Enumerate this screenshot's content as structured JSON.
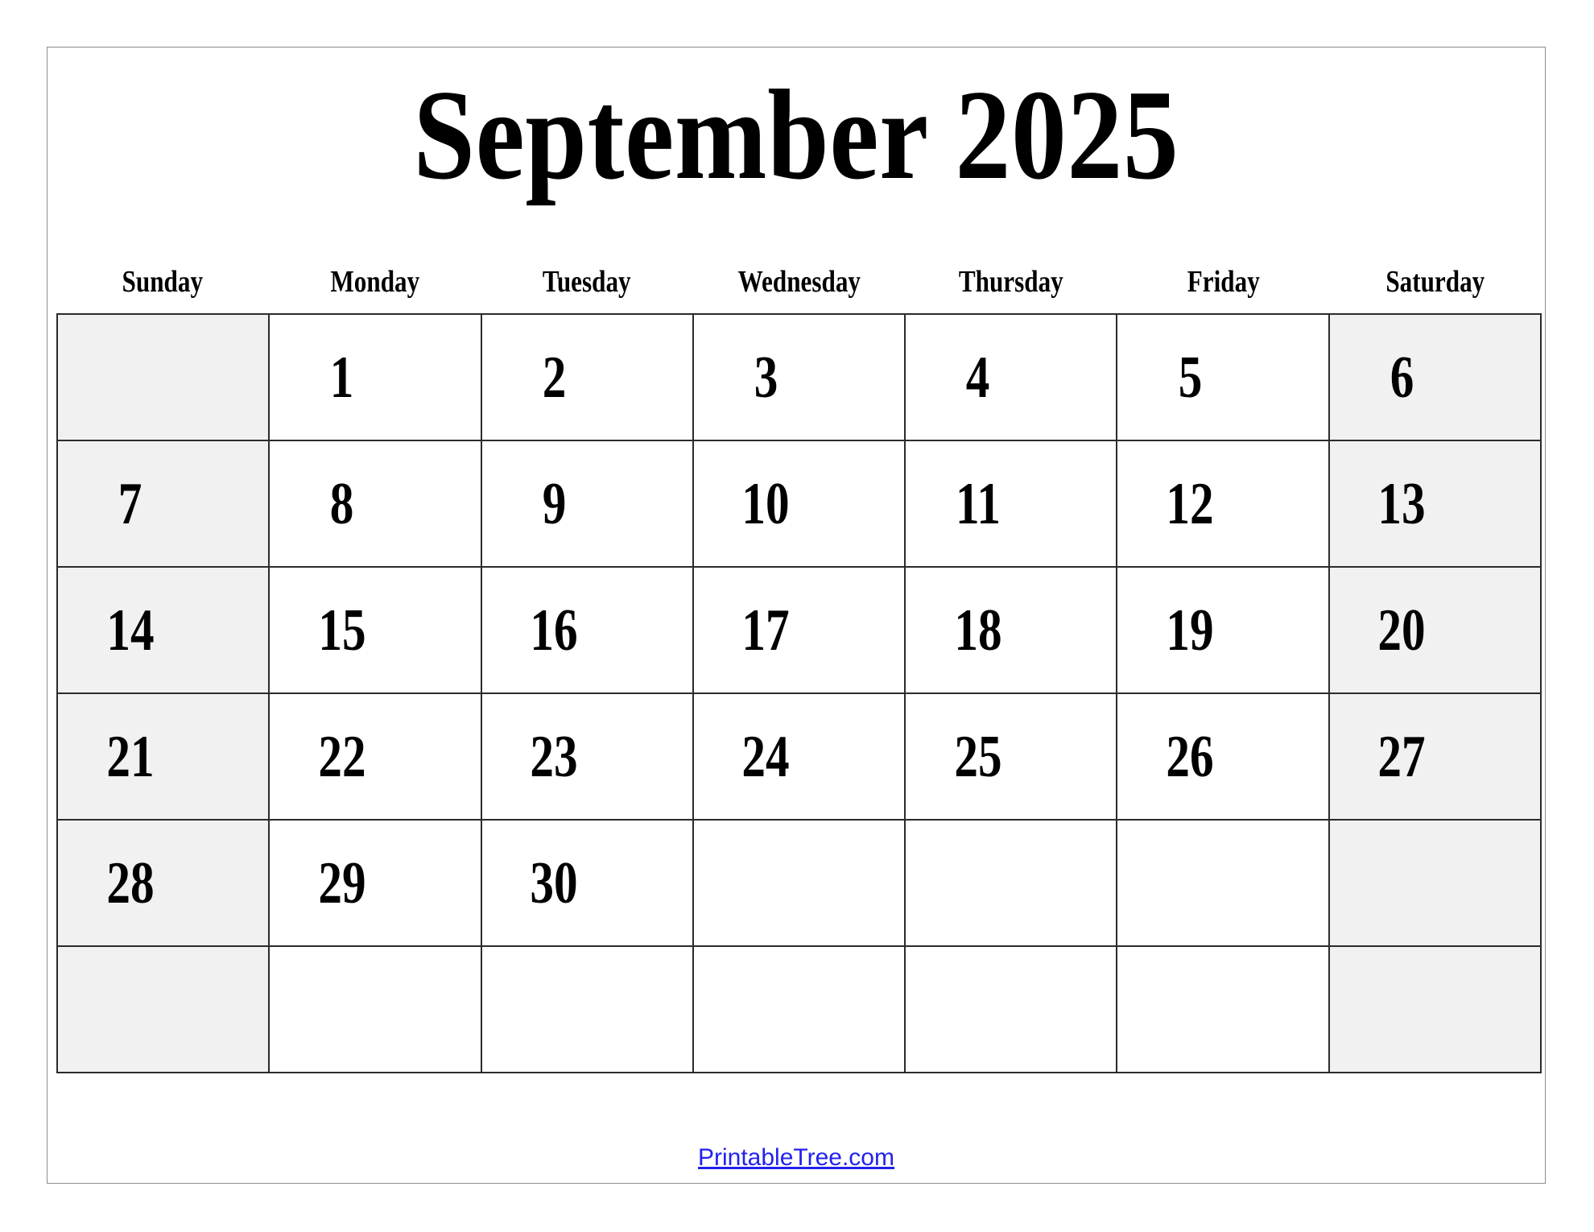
{
  "document": {
    "title": "September 2025",
    "month": "September",
    "year": "2025",
    "page_border_color": "#8c8c8c",
    "grid_border_color": "#2b2b2b",
    "weekend_shade_color": "#f1f1f1",
    "link_color": "#2222ee"
  },
  "weekday_headers": [
    {
      "label": "Sunday"
    },
    {
      "label": "Monday"
    },
    {
      "label": "Tuesday"
    },
    {
      "label": "Wednesday"
    },
    {
      "label": "Thursday"
    },
    {
      "label": "Friday"
    },
    {
      "label": "Saturday"
    }
  ],
  "calendar": {
    "first_day_of_week": "Sunday",
    "days_in_month": 30,
    "rows": 6,
    "columns": 7,
    "weeks": [
      {
        "cells": [
          {
            "date": "",
            "weekend": true
          },
          {
            "date": "1",
            "weekend": false
          },
          {
            "date": "2",
            "weekend": false
          },
          {
            "date": "3",
            "weekend": false
          },
          {
            "date": "4",
            "weekend": false
          },
          {
            "date": "5",
            "weekend": false
          },
          {
            "date": "6",
            "weekend": true
          }
        ]
      },
      {
        "cells": [
          {
            "date": "7",
            "weekend": true
          },
          {
            "date": "8",
            "weekend": false
          },
          {
            "date": "9",
            "weekend": false
          },
          {
            "date": "10",
            "weekend": false
          },
          {
            "date": "11",
            "weekend": false
          },
          {
            "date": "12",
            "weekend": false
          },
          {
            "date": "13",
            "weekend": true
          }
        ]
      },
      {
        "cells": [
          {
            "date": "14",
            "weekend": true
          },
          {
            "date": "15",
            "weekend": false
          },
          {
            "date": "16",
            "weekend": false
          },
          {
            "date": "17",
            "weekend": false
          },
          {
            "date": "18",
            "weekend": false
          },
          {
            "date": "19",
            "weekend": false
          },
          {
            "date": "20",
            "weekend": true
          }
        ]
      },
      {
        "cells": [
          {
            "date": "21",
            "weekend": true
          },
          {
            "date": "22",
            "weekend": false
          },
          {
            "date": "23",
            "weekend": false
          },
          {
            "date": "24",
            "weekend": false
          },
          {
            "date": "25",
            "weekend": false
          },
          {
            "date": "26",
            "weekend": false
          },
          {
            "date": "27",
            "weekend": true
          }
        ]
      },
      {
        "cells": [
          {
            "date": "28",
            "weekend": true
          },
          {
            "date": "29",
            "weekend": false
          },
          {
            "date": "30",
            "weekend": false
          },
          {
            "date": "",
            "weekend": false
          },
          {
            "date": "",
            "weekend": false
          },
          {
            "date": "",
            "weekend": false
          },
          {
            "date": "",
            "weekend": true
          }
        ]
      },
      {
        "cells": [
          {
            "date": "",
            "weekend": true
          },
          {
            "date": "",
            "weekend": false
          },
          {
            "date": "",
            "weekend": false
          },
          {
            "date": "",
            "weekend": false
          },
          {
            "date": "",
            "weekend": false
          },
          {
            "date": "",
            "weekend": false
          },
          {
            "date": "",
            "weekend": true
          }
        ]
      }
    ]
  },
  "footer": {
    "link_label": "PrintableTree.com"
  }
}
